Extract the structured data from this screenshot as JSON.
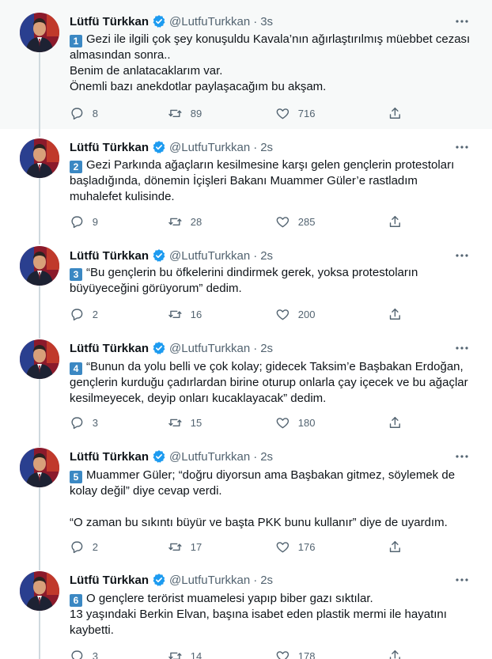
{
  "colors": {
    "accent": "#1d9bf0",
    "text": "#0f1419",
    "muted": "#536471",
    "number_badge": "#3b88c3"
  },
  "author": {
    "name": "Lütfü Türkkan",
    "handle": "@LutfuTurkkan",
    "verified_icon": "verified-badge-icon"
  },
  "tweets": [
    {
      "number": "1",
      "time": "3s",
      "lines": [
        "Gezi ile ilgili çok şey konuşuldu Kavala’nın ağırlaştırılmış müebbet cezası",
        "almasından sonra..",
        "Benim de anlatacaklarım var.",
        "Önemli bazı anekdotlar paylaşacağım bu akşam."
      ],
      "replies": "8",
      "retweets": "89",
      "likes": "716"
    },
    {
      "number": "2",
      "time": "2s",
      "lines": [
        "Gezi Parkında ağaçların kesilmesine karşı gelen gençlerin protestoları",
        "başladığında, dönemin İçişleri Bakanı Muammer Güler’e rastladım",
        "muhalefet kulisinde."
      ],
      "replies": "9",
      "retweets": "28",
      "likes": "285"
    },
    {
      "number": "3",
      "time": "2s",
      "lines": [
        "“Bu gençlerin bu öfkelerini dindirmek gerek, yoksa protestoların",
        "büyüyeceğini görüyorum” dedim."
      ],
      "replies": "2",
      "retweets": "16",
      "likes": "200"
    },
    {
      "number": "4",
      "time": "2s",
      "lines": [
        "“Bunun da yolu belli ve çok kolay; gidecek Taksim’e Başbakan Erdoğan,",
        "gençlerin kurduğu çadırlardan birine oturup onlarla çay içecek ve bu ağaçlar",
        "kesilmeyecek, deyip onları kucaklayacak” dedim."
      ],
      "replies": "3",
      "retweets": "15",
      "likes": "180"
    },
    {
      "number": "5",
      "time": "2s",
      "lines": [
        "Muammer Güler; “doğru diyorsun ama Başbakan gitmez, söylemek de",
        "kolay değil” diye cevap verdi.",
        "",
        "“O zaman bu sıkıntı büyür ve başta PKK bunu kullanır” diye de uyardım."
      ],
      "replies": "2",
      "retweets": "17",
      "likes": "176"
    },
    {
      "number": "6",
      "time": "2s",
      "lines": [
        "O gençlere terörist muamelesi yapıp biber gazı sıktılar.",
        "13 yaşındaki Berkin Elvan, başına isabet eden plastik mermi ile hayatını",
        "kaybetti."
      ],
      "replies": "3",
      "retweets": "14",
      "likes": "178"
    }
  ]
}
